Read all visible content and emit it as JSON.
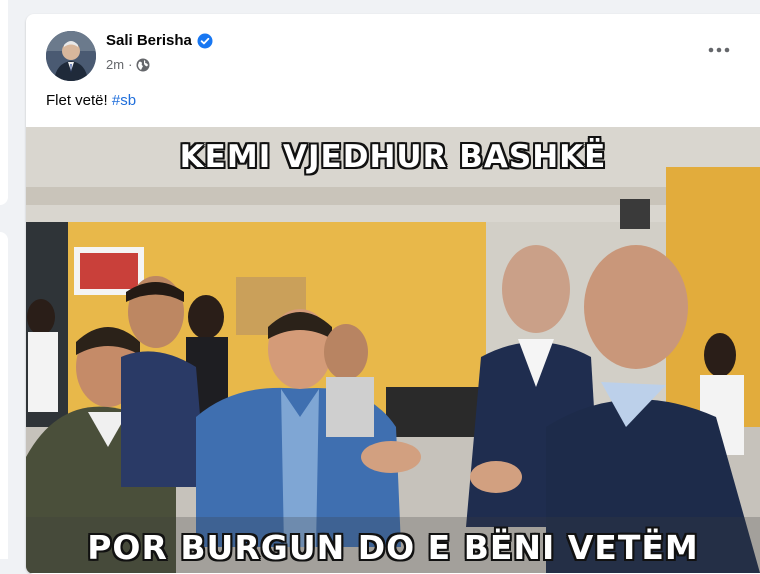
{
  "post": {
    "author": "Sali Berisha",
    "time": "2m",
    "separator": "·",
    "text": "Flet vetë!",
    "hashtag": "#sb"
  },
  "image": {
    "caption_top": "KEMI VJEDHUR BASHKË",
    "caption_bottom": "POR BURGUN DO E BËNI VETËM"
  },
  "icons": {
    "verified": "verified-badge-icon",
    "audience": "globe-icon",
    "more": "more-horizontal-icon"
  },
  "colors": {
    "background": "#f0f2f5",
    "card": "#ffffff",
    "accent_blue": "#1877f2",
    "hashtag": "#216fdb",
    "meta_text": "#65676b",
    "wall_yellow": "#e8b84a"
  }
}
